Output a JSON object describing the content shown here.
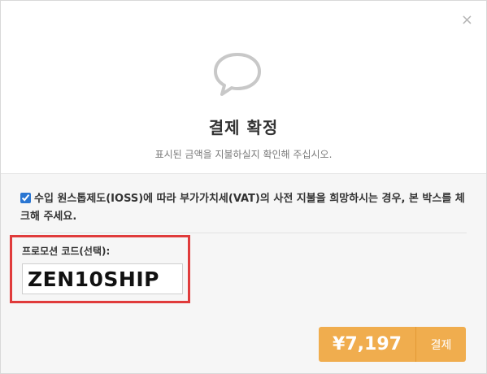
{
  "dialog": {
    "close_symbol": "×",
    "icon": "speech-bubble-icon",
    "title": "결제 확정",
    "subtitle": "표시된 금액을 지불하실지 확인해 주십시오."
  },
  "vat": {
    "checked": true,
    "text": "수입 원스톱제도(IOSS)에 따라 부가가치세(VAT)의 사전 지불을 희망하시는 경우, 본 박스를 체크해 주세요."
  },
  "promo": {
    "label": "프로모션 코드(선택):",
    "value": "ZEN10SHIP",
    "highlight_color": "#e03b3b"
  },
  "pay": {
    "amount": "¥7,197",
    "label": "결제",
    "color": "#f0ad4e"
  }
}
